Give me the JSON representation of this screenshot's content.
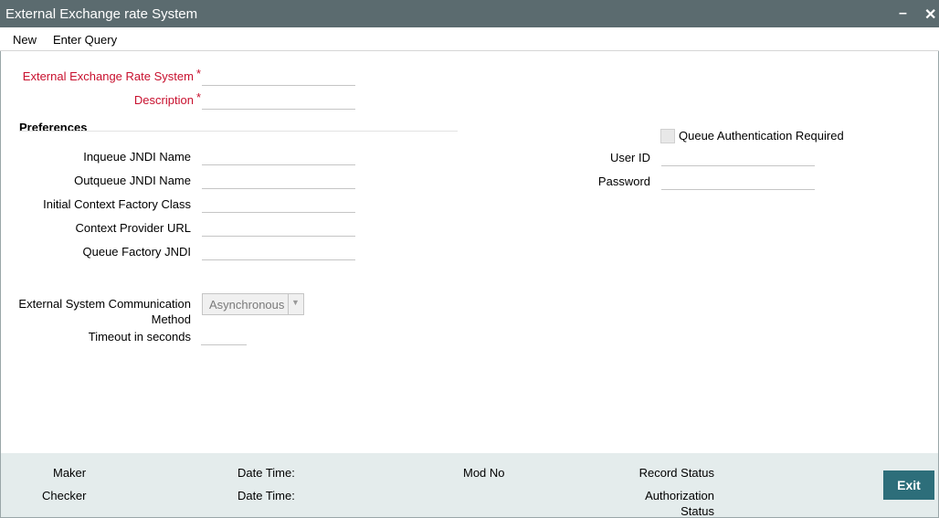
{
  "window": {
    "title": "External Exchange rate System",
    "minimize": "–",
    "close": "✕"
  },
  "menu": {
    "new": "New",
    "enter_query": "Enter Query"
  },
  "form": {
    "system_label": "External Exchange Rate System",
    "description_label": "Description",
    "required_mark": "*",
    "preferences_heading": "Preferences",
    "inqueue_label": "Inqueue JNDI Name",
    "outqueue_label": "Outqueue JNDI Name",
    "context_factory_label": "Initial Context Factory Class",
    "provider_url_label": "Context Provider URL",
    "queue_factory_label": "Queue Factory JNDI",
    "queue_auth_label": "Queue Authentication Required",
    "user_id_label": "User ID",
    "password_label": "Password",
    "comm_method_label_1": "External System Communication",
    "comm_method_label_2": "Method",
    "comm_method_value": "Asynchronous",
    "timeout_label": "Timeout in seconds"
  },
  "footer": {
    "maker": "Maker",
    "checker": "Checker",
    "date_time": "Date Time:",
    "mod_no": "Mod No",
    "record_status": "Record Status",
    "auth_status_1": "Authorization",
    "auth_status_2": "Status",
    "exit": "Exit"
  },
  "colors": {
    "titlebar": "#5b6b6f",
    "required": "#c8102e",
    "footer_bg": "#e4ecec",
    "exit_button": "#2d6e7a"
  }
}
